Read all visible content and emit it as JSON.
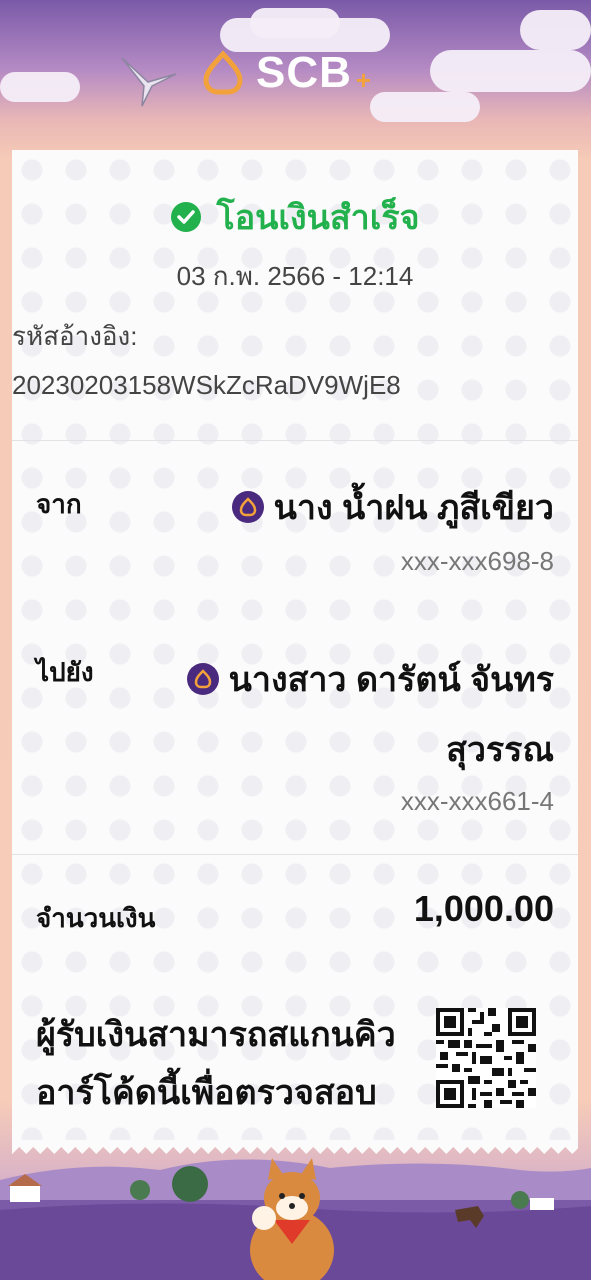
{
  "brand": {
    "name": "SCB",
    "plus": "+"
  },
  "status": {
    "text": "โอนเงินสำเร็จ",
    "color": "#22b14c"
  },
  "datetime": "03 ก.พ. 2566 - 12:14",
  "reference": {
    "label": "รหัสอ้างอิง:",
    "value": "20230203158WSkZcRaDV9WjE8"
  },
  "from": {
    "label": "จาก",
    "name": "นาง น้ำฝน ภูสีเขียว",
    "account": "xxx-xxx698-8"
  },
  "to": {
    "label": "ไปยัง",
    "name_line1": "นางสาว ดารัตน์ จันทร",
    "name_line2": "สุวรรณ",
    "account": "xxx-xxx661-4"
  },
  "amount": {
    "label": "จำนวนเงิน",
    "value": "1,000.00"
  },
  "verify": {
    "line1": "ผู้รับเงินสามารถสแกนคิว",
    "line2": "อาร์โค้ดนี้เพื่อตรวจสอบ"
  },
  "colors": {
    "brand_purple": "#4a2a7e",
    "logo_gold": "#f3a23b"
  },
  "icons": [
    "check-circle-icon",
    "scb-logo-icon",
    "bird-icon",
    "qr-code",
    "dog-mascot"
  ]
}
